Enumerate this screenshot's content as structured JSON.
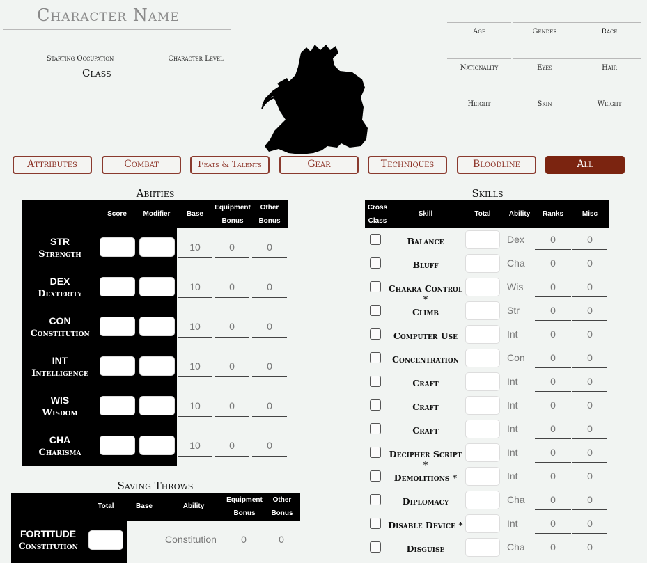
{
  "header": {
    "character_name": "Character Name",
    "starting_occupation_label": "Starting Occupation",
    "character_level_label": "Character Level",
    "class_label": "Class",
    "bio_labels": [
      "Age",
      "Gender",
      "Race",
      "Nationality",
      "Eyes",
      "Hair",
      "Height",
      "Skin",
      "Weight"
    ]
  },
  "portrait": {
    "icon": "ninja-silhouette-icon"
  },
  "nav": {
    "tabs": [
      {
        "label": "Attributes"
      },
      {
        "label": "Combat"
      },
      {
        "label": "Feats & Talents"
      },
      {
        "label": "Gear"
      },
      {
        "label": "Techniques"
      },
      {
        "label": "Bloodline"
      },
      {
        "label": "All"
      }
    ],
    "active": "All"
  },
  "abilities": {
    "title": "Abiities",
    "headers": {
      "score": "Score",
      "modifier": "Modifier",
      "base": "Base",
      "equip1": "Equipment",
      "equip2": "Bonus",
      "other1": "Other",
      "other2": "Bonus"
    },
    "rows": [
      {
        "abbr": "STR",
        "name": "Strength",
        "base": "10",
        "equip": "0",
        "other": "0"
      },
      {
        "abbr": "DEX",
        "name": "Dexterity",
        "base": "10",
        "equip": "0",
        "other": "0"
      },
      {
        "abbr": "CON",
        "name": "Constitution",
        "base": "10",
        "equip": "0",
        "other": "0"
      },
      {
        "abbr": "INT",
        "name": "Intelligence",
        "base": "10",
        "equip": "0",
        "other": "0"
      },
      {
        "abbr": "WIS",
        "name": "Wisdom",
        "base": "10",
        "equip": "0",
        "other": "0"
      },
      {
        "abbr": "CHA",
        "name": "Charisma",
        "base": "10",
        "equip": "0",
        "other": "0"
      }
    ]
  },
  "saving_throws": {
    "title": "Saving Throws",
    "headers": {
      "total": "Total",
      "base": "Base",
      "ability": "Ability",
      "equip1": "Equipment",
      "equip2": "Bonus",
      "other1": "Other",
      "other2": "Bonus"
    },
    "rows": [
      {
        "name": "FORTITUDE",
        "sub": "Constitution",
        "ability": "Constitution",
        "equip": "0",
        "other": "0"
      }
    ]
  },
  "skills": {
    "title": "Skills",
    "headers": {
      "cross1": "Cross",
      "cross2": "Class",
      "skill": "Skill",
      "total": "Total",
      "ability": "Ability",
      "ranks": "Ranks",
      "misc": "Misc"
    },
    "rows": [
      {
        "name": "Balance",
        "ability": "Dex",
        "ranks": "0",
        "misc": "0"
      },
      {
        "name": "Bluff",
        "ability": "Cha",
        "ranks": "0",
        "misc": "0"
      },
      {
        "name": "Chakra Control *",
        "ability": "Wis",
        "ranks": "0",
        "misc": "0"
      },
      {
        "name": "Climb",
        "ability": "Str",
        "ranks": "0",
        "misc": "0"
      },
      {
        "name": "Computer Use",
        "ability": "Int",
        "ranks": "0",
        "misc": "0"
      },
      {
        "name": "Concentration",
        "ability": "Con",
        "ranks": "0",
        "misc": "0"
      },
      {
        "name": "Craft",
        "ability": "Int",
        "ranks": "0",
        "misc": "0"
      },
      {
        "name": "Craft",
        "ability": "Int",
        "ranks": "0",
        "misc": "0"
      },
      {
        "name": "Craft",
        "ability": "Int",
        "ranks": "0",
        "misc": "0"
      },
      {
        "name": "Decipher Script *",
        "ability": "Int",
        "ranks": "0",
        "misc": "0"
      },
      {
        "name": "Demolitions *",
        "ability": "Int",
        "ranks": "0",
        "misc": "0"
      },
      {
        "name": "Diplomacy",
        "ability": "Cha",
        "ranks": "0",
        "misc": "0"
      },
      {
        "name": "Disable Device *",
        "ability": "Int",
        "ranks": "0",
        "misc": "0"
      },
      {
        "name": "Disguise",
        "ability": "Cha",
        "ranks": "0",
        "misc": "0"
      }
    ]
  }
}
